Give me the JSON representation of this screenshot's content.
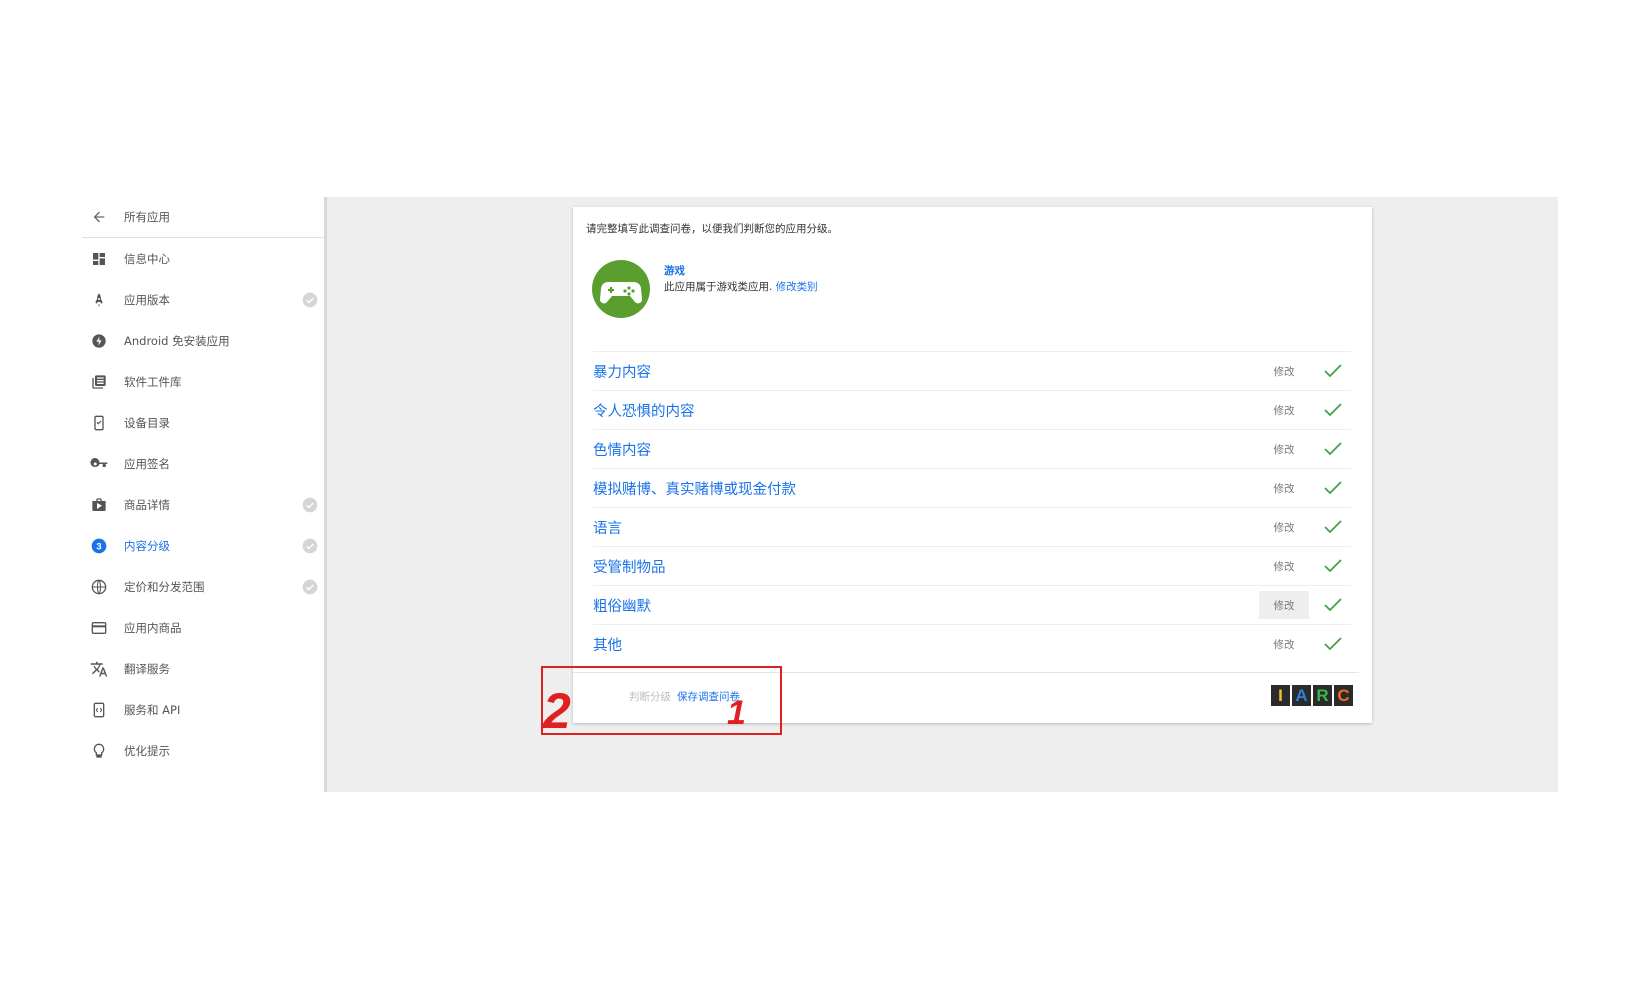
{
  "sidebar": {
    "items": [
      {
        "label": "所有应用",
        "icon": "arrow-back-icon",
        "done": false,
        "active": false
      },
      {
        "label": "信息中心",
        "icon": "dashboard-icon",
        "done": false,
        "active": false
      },
      {
        "label": "应用版本",
        "icon": "rocket-icon",
        "done": true,
        "active": false
      },
      {
        "label": "Android 免安装应用",
        "icon": "bolt-icon",
        "done": false,
        "active": false
      },
      {
        "label": "软件工件库",
        "icon": "library-icon",
        "done": false,
        "active": false
      },
      {
        "label": "设备目录",
        "icon": "device-icon",
        "done": false,
        "active": false
      },
      {
        "label": "应用签名",
        "icon": "key-icon",
        "done": false,
        "active": false
      },
      {
        "label": "商品详情",
        "icon": "shopping-bag-icon",
        "done": true,
        "active": false
      },
      {
        "label": "内容分级",
        "icon": "content-rating-icon",
        "done": true,
        "active": true
      },
      {
        "label": "定价和分发范围",
        "icon": "globe-icon",
        "done": true,
        "active": false
      },
      {
        "label": "应用内商品",
        "icon": "credit-card-icon",
        "done": false,
        "active": false
      },
      {
        "label": "翻译服务",
        "icon": "translate-icon",
        "done": false,
        "active": false
      },
      {
        "label": "服务和 API",
        "icon": "api-icon",
        "done": false,
        "active": false
      },
      {
        "label": "优化提示",
        "icon": "lightbulb-icon",
        "done": false,
        "active": false
      }
    ]
  },
  "card": {
    "intro": "请完整填写此调查问卷，以便我们判断您的应用分级。",
    "category": {
      "title": "游戏",
      "description": "此应用属于游戏类应用.",
      "change_link": "修改类别",
      "icon": "gamepad-icon"
    },
    "rows": [
      {
        "label": "暴力内容",
        "edit": "修改",
        "done": true
      },
      {
        "label": "令人恐惧的内容",
        "edit": "修改",
        "done": true
      },
      {
        "label": "色情内容",
        "edit": "修改",
        "done": true
      },
      {
        "label": "模拟赌博、真实赌博或现金付款",
        "edit": "修改",
        "done": true
      },
      {
        "label": "语言",
        "edit": "修改",
        "done": true
      },
      {
        "label": "受管制物品",
        "edit": "修改",
        "done": true
      },
      {
        "label": "粗俗幽默",
        "edit": "修改",
        "done": true,
        "hover": true
      },
      {
        "label": "其他",
        "edit": "修改",
        "done": true
      }
    ],
    "footer": {
      "calc_label": "判断分级",
      "save_label": "保存调查问卷",
      "logo": [
        "I",
        "A",
        "R",
        "C"
      ]
    }
  },
  "annotation": {
    "labels": [
      "2",
      "1"
    ]
  },
  "colors": {
    "accent": "#1a73e8",
    "check": "#43a047",
    "game_icon_bg": "#5a9e2f",
    "annotation": "#e02020",
    "iarc_I": "#f2c12e",
    "iarc_A": "#2f7fd6",
    "iarc_R": "#3cb54a",
    "iarc_C": "#f26b21"
  }
}
